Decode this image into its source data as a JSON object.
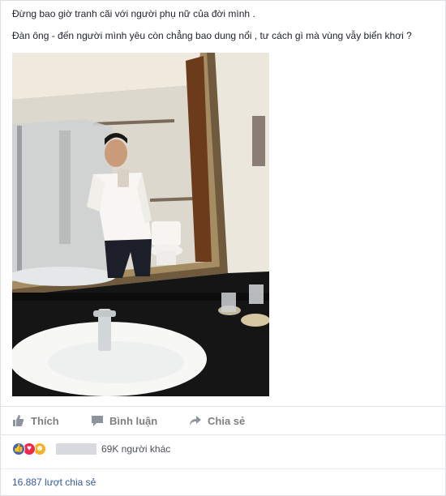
{
  "post": {
    "line1": "Đừng bao giờ tranh cãi với người phụ nữ của đời mình .",
    "line2": "Đàn ông - đến người mình yêu còn chẳng bao dung nổi , tư cách gì mà vùng vẫy biển khơi ?"
  },
  "actions": {
    "like_label": "Thích",
    "comment_label": "Bình luận",
    "share_label": "Chia sẻ"
  },
  "reactions": {
    "summary": "69K người khác",
    "icons": [
      "like-icon",
      "love-icon",
      "haha-icon"
    ]
  },
  "shares": {
    "count_label": "16.887 lượt chia sẻ"
  },
  "colors": {
    "action_gray": "#7f7f7f",
    "link_blue": "#365899",
    "like_blue": "#4267b2",
    "love_red": "#f0284a",
    "haha_yellow": "#f7b125"
  }
}
